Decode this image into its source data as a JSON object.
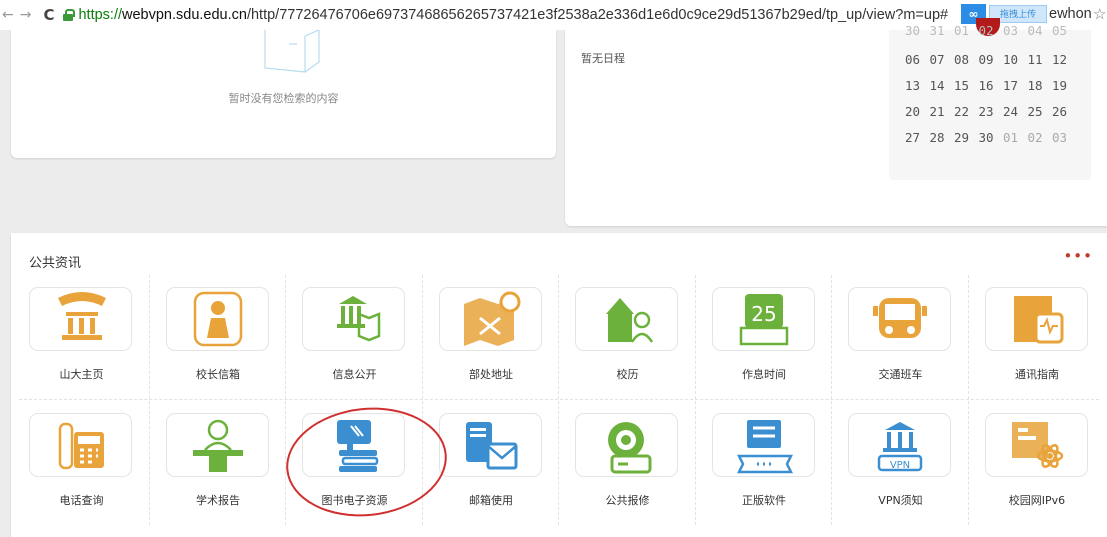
{
  "browser": {
    "url_secure": "https://",
    "url_host": "webvpn.sdu.edu.cn",
    "url_path": "/http/77726476706e69737468656265737421e3f2538a2e336d1e6d0c9ce29d51367b29ed/tp_up/view?m=up#",
    "url_tail": "ewhon",
    "upload_icon_text": "∞",
    "upload_label": "拖拽上传"
  },
  "search": {
    "empty_text": "暂时没有您检索的内容"
  },
  "schedule": {
    "empty_text": "暂无日程",
    "calendar": {
      "row0": [
        "30",
        "31",
        "01",
        "02",
        "03",
        "04",
        "05"
      ],
      "row1": [
        "06",
        "07",
        "08",
        "09",
        "10",
        "11",
        "12"
      ],
      "row2": [
        "13",
        "14",
        "15",
        "16",
        "17",
        "18",
        "19"
      ],
      "row3": [
        "20",
        "21",
        "22",
        "23",
        "24",
        "25",
        "26"
      ],
      "row4": [
        "27",
        "28",
        "29",
        "30",
        "01",
        "02",
        "03"
      ]
    }
  },
  "public_info": {
    "title": "公共资讯",
    "more": "•••",
    "items": [
      {
        "label": "山大主页",
        "icon": "university-welcome-icon",
        "color": "#e8a33b"
      },
      {
        "label": "校长信箱",
        "icon": "president-mailbox-icon",
        "color": "#e8a33b"
      },
      {
        "label": "信息公开",
        "icon": "info-disclosure-icon",
        "color": "#6bb13b"
      },
      {
        "label": "部处地址",
        "icon": "map-location-icon",
        "color": "#e8a33b"
      },
      {
        "label": "校历",
        "icon": "school-calendar-icon",
        "color": "#6bb13b"
      },
      {
        "label": "作息时间",
        "icon": "schedule-time-icon",
        "color": "#6bb13b"
      },
      {
        "label": "交通班车",
        "icon": "bus-icon",
        "color": "#e8a33b"
      },
      {
        "label": "通讯指南",
        "icon": "contact-guide-icon",
        "color": "#e8a33b"
      },
      {
        "label": "电话查询",
        "icon": "telephone-icon",
        "color": "#e8a33b"
      },
      {
        "label": "学术报告",
        "icon": "academic-report-icon",
        "color": "#6bb13b"
      },
      {
        "label": "图书电子资源",
        "icon": "library-eresource-icon",
        "color": "#3b8fd0"
      },
      {
        "label": "邮箱使用",
        "icon": "mailbox-icon",
        "color": "#3b8fd0"
      },
      {
        "label": "公共报修",
        "icon": "repair-icon",
        "color": "#6bb13b"
      },
      {
        "label": "正版软件",
        "icon": "licensed-software-icon",
        "color": "#3b8fd0"
      },
      {
        "label": "VPN须知",
        "icon": "vpn-icon",
        "color": "#3b8fd0"
      },
      {
        "label": "校园网IPv6",
        "icon": "ipv6-icon",
        "color": "#e8a33b"
      }
    ]
  }
}
